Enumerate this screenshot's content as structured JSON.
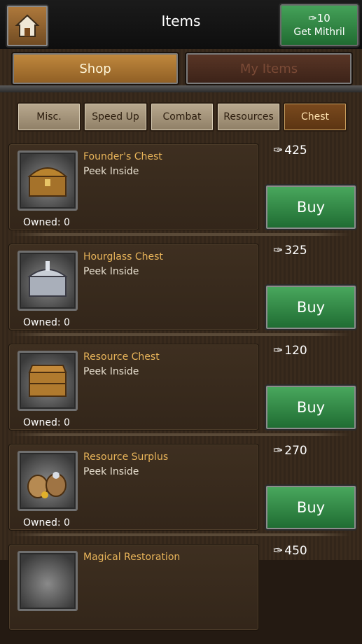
{
  "header": {
    "title": "Items",
    "mithril_count": "10",
    "mithril_label": "Get Mithril"
  },
  "tabs": {
    "shop": "Shop",
    "my_items": "My Items"
  },
  "categories": [
    "Misc.",
    "Speed Up",
    "Combat",
    "Resources",
    "Chest"
  ],
  "active_category": "Chest",
  "items": [
    {
      "name": "Founder's Chest",
      "subtitle": "Peek Inside",
      "owned": "Owned: 0",
      "price": "425",
      "buy": "Buy"
    },
    {
      "name": "Hourglass Chest",
      "subtitle": "Peek Inside",
      "owned": "Owned: 0",
      "price": "325",
      "buy": "Buy"
    },
    {
      "name": "Resource Chest",
      "subtitle": "Peek Inside",
      "owned": "Owned: 0",
      "price": "120",
      "buy": "Buy"
    },
    {
      "name": "Resource Surplus",
      "subtitle": "Peek Inside",
      "owned": "Owned: 0",
      "price": "270",
      "buy": "Buy"
    },
    {
      "name": "Magical Restoration",
      "price": "450"
    }
  ],
  "colors": {
    "accent_green": "#2f8a44",
    "item_name": "#e8b45a",
    "shop_tab": "#b07a36"
  }
}
